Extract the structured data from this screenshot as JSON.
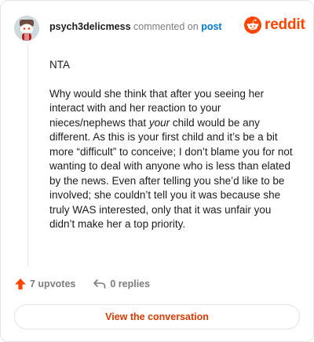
{
  "header": {
    "username": "psych3delicmess",
    "action_text": "commented on",
    "post_link": "post"
  },
  "brand": {
    "wordmark": "reddit",
    "icon": "reddit-snoo-icon",
    "color": "#ff4500"
  },
  "comment": {
    "paragraph_1": "NTA",
    "paragraph_2_part_1": "Why would she think that after you seeing her interact with and her reaction to your nieces/nephews that ",
    "paragraph_2_emphasis": "your",
    "paragraph_2_part_2": " child would be any different. As this is your first child and it’s be a bit more “difficult” to conceive; I don’t blame you for not wanting to deal with anyone who is less than elated by the news. Even after telling you she’d like to be involved; she couldn’t tell you it was because she truly WAS interested, only that it was unfair you didn’t make her a top priority."
  },
  "stats": {
    "upvotes_label": "7 upvotes",
    "upvote_icon": "upvote-arrow-icon",
    "upvote_color": "#ff4500",
    "replies_label": "0 replies",
    "reply_icon": "reply-arrow-icon"
  },
  "cta": {
    "label": "View the conversation",
    "color": "#d93a00"
  }
}
